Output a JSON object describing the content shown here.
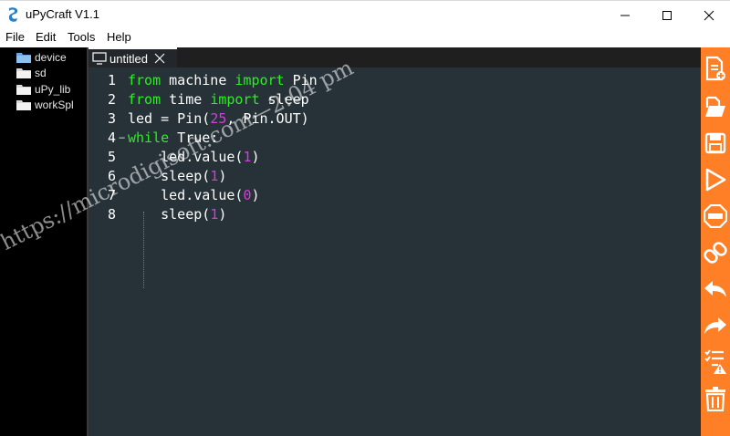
{
  "window": {
    "title": "uPyCraft V1.1",
    "controls": [
      "minimize-icon",
      "maximize-icon",
      "close-icon"
    ]
  },
  "menu": [
    "File",
    "Edit",
    "Tools",
    "Help"
  ],
  "sidebar": {
    "items": [
      {
        "label": "device",
        "icon": "folder-icon"
      },
      {
        "label": "sd",
        "icon": "folder-icon"
      },
      {
        "label": "uPy_lib",
        "icon": "folder-icon"
      },
      {
        "label": "workSpl",
        "icon": "folder-icon"
      }
    ]
  },
  "tabs": [
    {
      "label": "untitled",
      "icon": "monitor-icon",
      "close": "close-icon"
    }
  ],
  "editor": {
    "lines": [
      {
        "n": "1",
        "tokens": [
          {
            "t": "from",
            "c": "kw"
          },
          {
            "t": " machine ",
            "c": ""
          },
          {
            "t": "import",
            "c": "kw"
          },
          {
            "t": " Pin",
            "c": ""
          }
        ]
      },
      {
        "n": "2",
        "tokens": [
          {
            "t": "from",
            "c": "kw"
          },
          {
            "t": " time ",
            "c": ""
          },
          {
            "t": "import",
            "c": "kw"
          },
          {
            "t": " sleep",
            "c": ""
          }
        ]
      },
      {
        "n": "3",
        "tokens": [
          {
            "t": "led = Pin(",
            "c": ""
          },
          {
            "t": "25",
            "c": "num"
          },
          {
            "t": ", Pin.OUT)",
            "c": ""
          }
        ]
      },
      {
        "n": "4",
        "tokens": [
          {
            "t": "while",
            "c": "kw"
          },
          {
            "t": " True:",
            "c": ""
          }
        ]
      },
      {
        "n": "5",
        "tokens": [
          {
            "t": "    led.value(",
            "c": ""
          },
          {
            "t": "1",
            "c": "num"
          },
          {
            "t": ")",
            "c": ""
          }
        ]
      },
      {
        "n": "6",
        "tokens": [
          {
            "t": "    sleep(",
            "c": ""
          },
          {
            "t": "1",
            "c": "num"
          },
          {
            "t": ")",
            "c": ""
          }
        ]
      },
      {
        "n": "7",
        "tokens": [
          {
            "t": "    led.value(",
            "c": ""
          },
          {
            "t": "0",
            "c": "num"
          },
          {
            "t": ")",
            "c": ""
          }
        ]
      },
      {
        "n": "8",
        "tokens": [
          {
            "t": "    sleep(",
            "c": ""
          },
          {
            "t": "1",
            "c": "num"
          },
          {
            "t": ")",
            "c": ""
          }
        ]
      }
    ]
  },
  "toolbar": [
    "new-file-icon",
    "open-file-icon",
    "save-icon",
    "run-icon",
    "stop-icon",
    "connect-icon",
    "undo-icon",
    "redo-icon",
    "syntax-check-icon",
    "clear-icon"
  ],
  "watermark": "https://microdigisoft.com—2:04 pm",
  "colors": {
    "editor_bg": "#263238",
    "keyword": "#29f01f",
    "number": "#d23fd8",
    "toolbar_bg": "#ff7f27",
    "sidebar_bg": "#000000"
  }
}
